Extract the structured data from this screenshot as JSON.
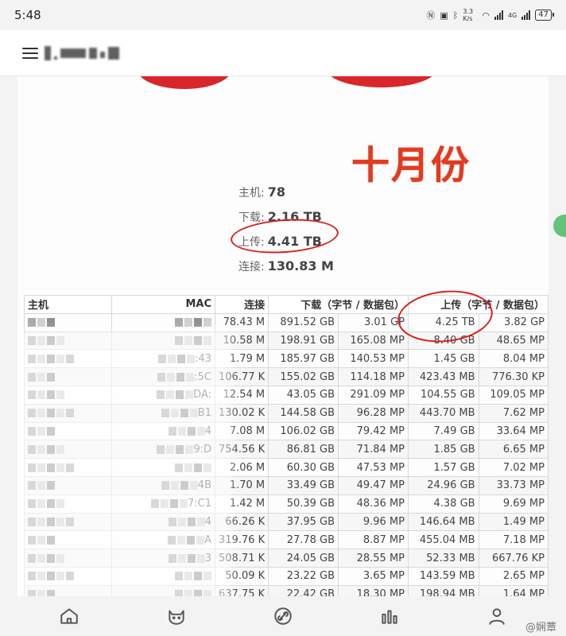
{
  "status_bar": {
    "time": "5:48",
    "speed": "3.3 K/s",
    "network": "4G",
    "battery": "47"
  },
  "summary": {
    "host_label": "主机:",
    "host_value": "78",
    "download_label": "下载:",
    "download_value": "2.16 TB",
    "upload_label": "上传:",
    "upload_value": "4.41 TB",
    "connections_label": "连接:",
    "connections_value": "130.83 M"
  },
  "annotation": "十月份",
  "table": {
    "headers": {
      "host": "主机",
      "mac": "MAC",
      "connections": "连接",
      "download": "下载（字节 / 数据包）",
      "upload": "上传（字节 / 数据包）"
    },
    "rows": [
      {
        "mac": "",
        "connections": "78.43 M",
        "dl_bytes": "891.52 GB",
        "dl_packets": "3.01 GP",
        "ul_bytes": "4.25 TB",
        "ul_packets": "3.82 GP"
      },
      {
        "mac": "",
        "connections": "10.58 M",
        "dl_bytes": "198.91 GB",
        "dl_packets": "165.08 MP",
        "ul_bytes": "8.40 GB",
        "ul_packets": "48.65 MP"
      },
      {
        "mac": ":43",
        "connections": "1.79 M",
        "dl_bytes": "185.97 GB",
        "dl_packets": "140.53 MP",
        "ul_bytes": "1.45 GB",
        "ul_packets": "8.04 MP"
      },
      {
        "mac": ":5C",
        "connections": "106.77 K",
        "dl_bytes": "155.02 GB",
        "dl_packets": "114.18 MP",
        "ul_bytes": "423.43 MB",
        "ul_packets": "776.30 KP"
      },
      {
        "mac": "DA:",
        "connections": "12.54 M",
        "dl_bytes": "43.05 GB",
        "dl_packets": "291.09 MP",
        "ul_bytes": "104.55 GB",
        "ul_packets": "109.05 MP"
      },
      {
        "mac": "B1",
        "connections": "130.02 K",
        "dl_bytes": "144.58 GB",
        "dl_packets": "96.28 MP",
        "ul_bytes": "443.70 MB",
        "ul_packets": "7.62 MP"
      },
      {
        "mac": "4",
        "connections": "7.08 M",
        "dl_bytes": "106.02 GB",
        "dl_packets": "79.42 MP",
        "ul_bytes": "7.49 GB",
        "ul_packets": "33.64 MP"
      },
      {
        "mac": "9:D",
        "connections": "754.56 K",
        "dl_bytes": "86.81 GB",
        "dl_packets": "71.84 MP",
        "ul_bytes": "1.85 GB",
        "ul_packets": "6.65 MP"
      },
      {
        "mac": "",
        "connections": "2.06 M",
        "dl_bytes": "60.30 GB",
        "dl_packets": "47.53 MP",
        "ul_bytes": "1.57 GB",
        "ul_packets": "7.02 MP"
      },
      {
        "mac": "4B",
        "connections": "1.70 M",
        "dl_bytes": "33.49 GB",
        "dl_packets": "49.47 MP",
        "ul_bytes": "24.96 GB",
        "ul_packets": "33.73 MP"
      },
      {
        "mac": "7:C1",
        "connections": "1.42 M",
        "dl_bytes": "50.39 GB",
        "dl_packets": "48.36 MP",
        "ul_bytes": "4.38 GB",
        "ul_packets": "9.69 MP"
      },
      {
        "mac": "4",
        "connections": "66.26 K",
        "dl_bytes": "37.95 GB",
        "dl_packets": "9.96 MP",
        "ul_bytes": "146.64 MB",
        "ul_packets": "1.49 MP"
      },
      {
        "mac": "A",
        "connections": "319.76 K",
        "dl_bytes": "27.78 GB",
        "dl_packets": "8.87 MP",
        "ul_bytes": "455.04 MB",
        "ul_packets": "7.18 MP"
      },
      {
        "mac": "3",
        "connections": "508.71 K",
        "dl_bytes": "24.05 GB",
        "dl_packets": "28.55 MP",
        "ul_bytes": "52.33 MB",
        "ul_packets": "667.76 KP"
      },
      {
        "mac": "",
        "connections": "50.09 K",
        "dl_bytes": "23.22 GB",
        "dl_packets": "3.65 MP",
        "ul_bytes": "143.59 MB",
        "ul_packets": "2.65 MP"
      },
      {
        "mac": "",
        "connections": "637.75 K",
        "dl_bytes": "22.42 GB",
        "dl_packets": "18.30 MP",
        "ul_bytes": "198.94 MB",
        "ul_packets": "1.64 MP"
      }
    ]
  },
  "watermark": "@娴蕈",
  "colors": {
    "annotation_red": "#e23b1f",
    "circle_red": "#d9211c",
    "side_tab_green": "#64c27a"
  },
  "bottom_nav": {
    "icons": [
      "home-icon",
      "cat-face-icon",
      "link-icon",
      "bar-chart-icon",
      "person-icon"
    ]
  }
}
